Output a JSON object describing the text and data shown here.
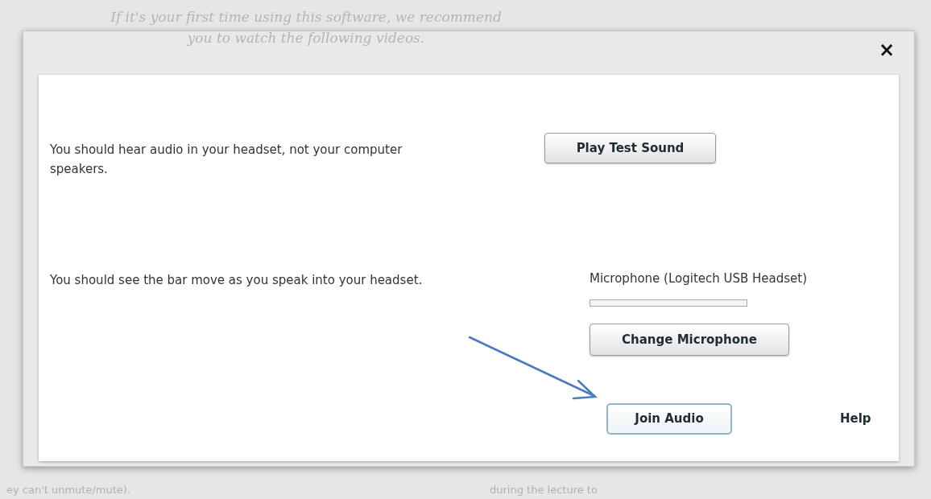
{
  "background": {
    "intro": [
      "If it's your first time using this software, we recommend",
      "you to watch the following videos."
    ],
    "fragments": [
      "ey can't unmute/mute).",
      "during the lecture to"
    ]
  },
  "dialog": {
    "close": "×",
    "speaker_test": {
      "instruction": "You should hear audio in your headset, not your computer speakers.",
      "button": "Play Test Sound"
    },
    "mic_test": {
      "instruction": "You should see the bar move as you speak into your headset.",
      "device": "Microphone (Logitech USB Headset)",
      "level": 0,
      "button": "Change Microphone"
    },
    "join_button": "Join Audio",
    "help": "Help"
  }
}
